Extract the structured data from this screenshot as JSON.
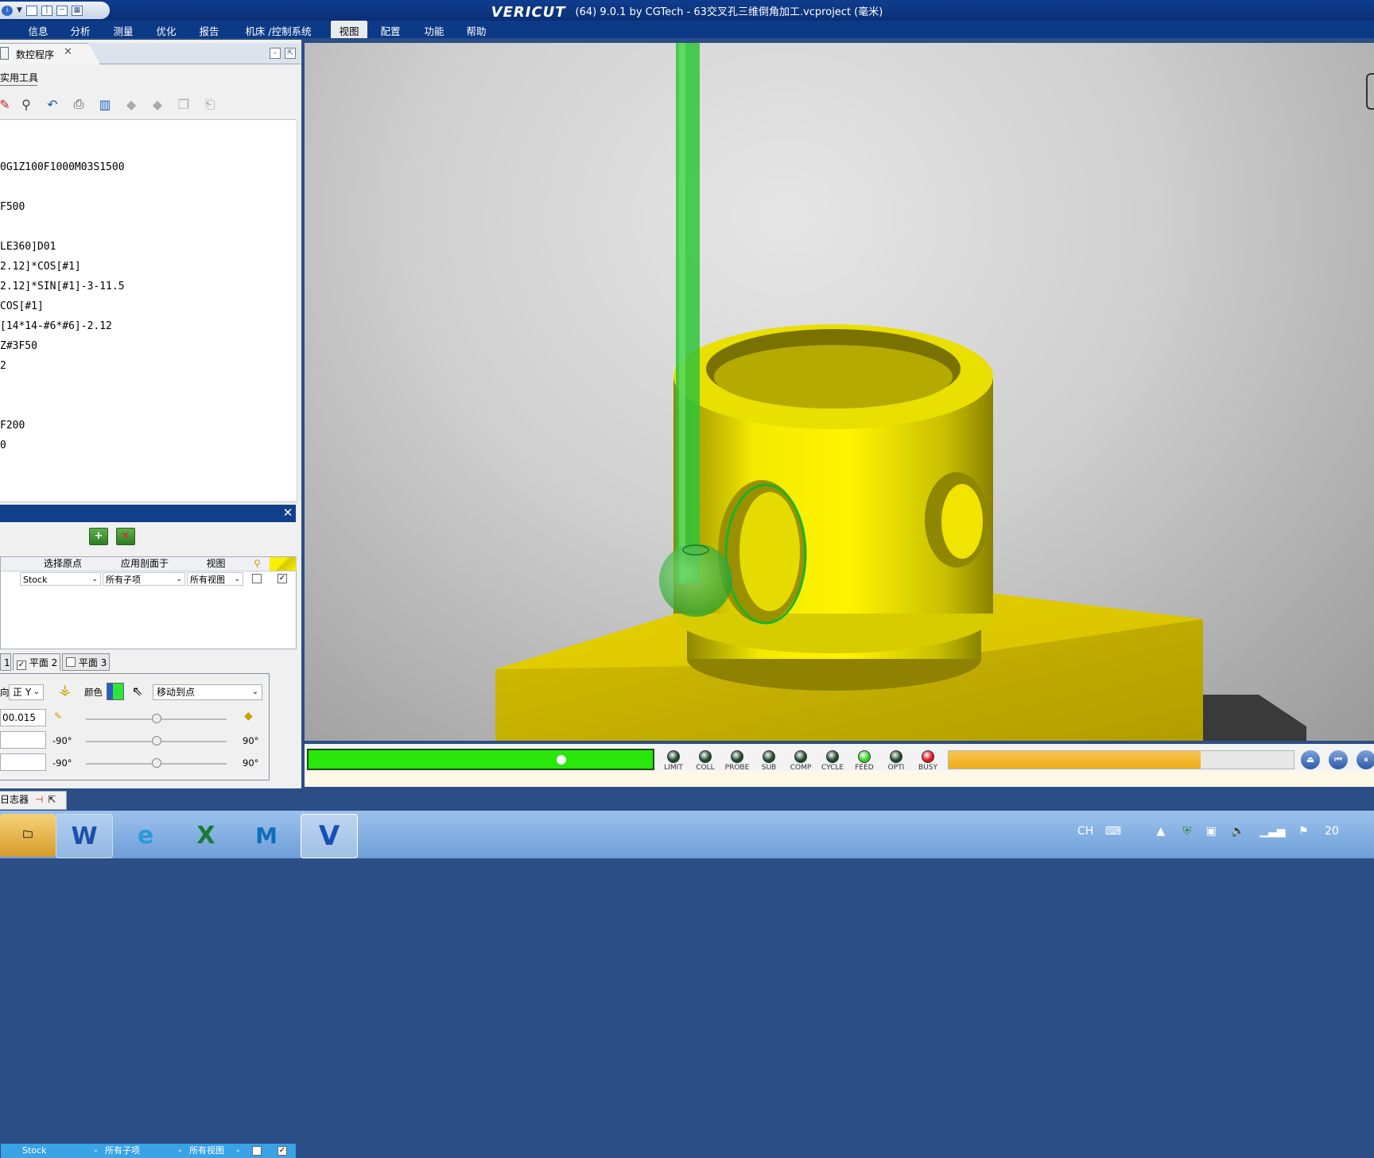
{
  "window": {
    "title_prefix": "VERICUT",
    "title": "(64)  9.0.1 by CGTech - 63交叉孔三维倒角加工.vcproject (毫米)"
  },
  "menu": {
    "items": [
      "信息",
      "分析",
      "测量",
      "优化",
      "报告",
      "机床 /控制系统",
      "视图",
      "配置",
      "功能",
      "帮助"
    ],
    "active": "视图"
  },
  "nc_panel": {
    "tab_label": "数控程序",
    "tools_label": "实用工具",
    "code_lines": [
      "0G1Z100F1000M03S1500",
      "",
      "F500",
      "",
      "LE360]D01",
      "2.12]*COS[#1]",
      "2.12]*SIN[#1]-3-11.5",
      "COS[#1]",
      "[14*14-#6*#6]-2.12",
      "Z#3F50",
      "2",
      "",
      "",
      "F200",
      "0"
    ]
  },
  "section_panel": {
    "columns": [
      "选择原点",
      "应用剖面于",
      "视图"
    ],
    "rows": [
      {
        "origin": "Stock",
        "apply": "所有子项",
        "view": "所有视图",
        "c1": false,
        "c2": true,
        "selected": false
      },
      {
        "origin": "Stock",
        "apply": "所有子项",
        "view": "所有视图",
        "c1": false,
        "c2": true,
        "selected": true
      }
    ],
    "plane_tabs": [
      {
        "label": "1",
        "checked": null
      },
      {
        "label": "平面 2",
        "checked": true
      },
      {
        "label": "平面 3",
        "checked": false
      }
    ],
    "direction_label": "向",
    "direction_value": "正 Y",
    "color_label": "颜色",
    "move_value": "移动到点",
    "offset_value": "00.015",
    "angle_min": "-90°",
    "angle_max": "90°"
  },
  "logger_tab": "日志器",
  "status": {
    "leds": [
      {
        "label": "LIMIT",
        "color": "#1a4a2a"
      },
      {
        "label": "COLL",
        "color": "#1a4a2a"
      },
      {
        "label": "PROBE",
        "color": "#1a4a2a"
      },
      {
        "label": "SUB",
        "color": "#1a4a2a"
      },
      {
        "label": "COMP",
        "color": "#1a4a2a"
      },
      {
        "label": "CYCLE",
        "color": "#1a4a2a"
      },
      {
        "label": "FEED",
        "color": "#38d02a"
      },
      {
        "label": "OPTI",
        "color": "#1a4a2a"
      },
      {
        "label": "BUSY",
        "color": "#e0141c"
      }
    ],
    "sim_progress": 0.74,
    "cut_progress": 0.73
  },
  "taskbar": {
    "apps": [
      "explorer",
      "word",
      "ie",
      "excel",
      "mastercam",
      "vericut"
    ],
    "tray_lang": "CH",
    "clock": "20"
  },
  "colors": {
    "title_bg": "#0a2f74",
    "part_yellow": "#f0e000",
    "tool_green": "#2fc43a",
    "progress_green": "#29e60b",
    "progress_orange": "#f0ac19"
  }
}
